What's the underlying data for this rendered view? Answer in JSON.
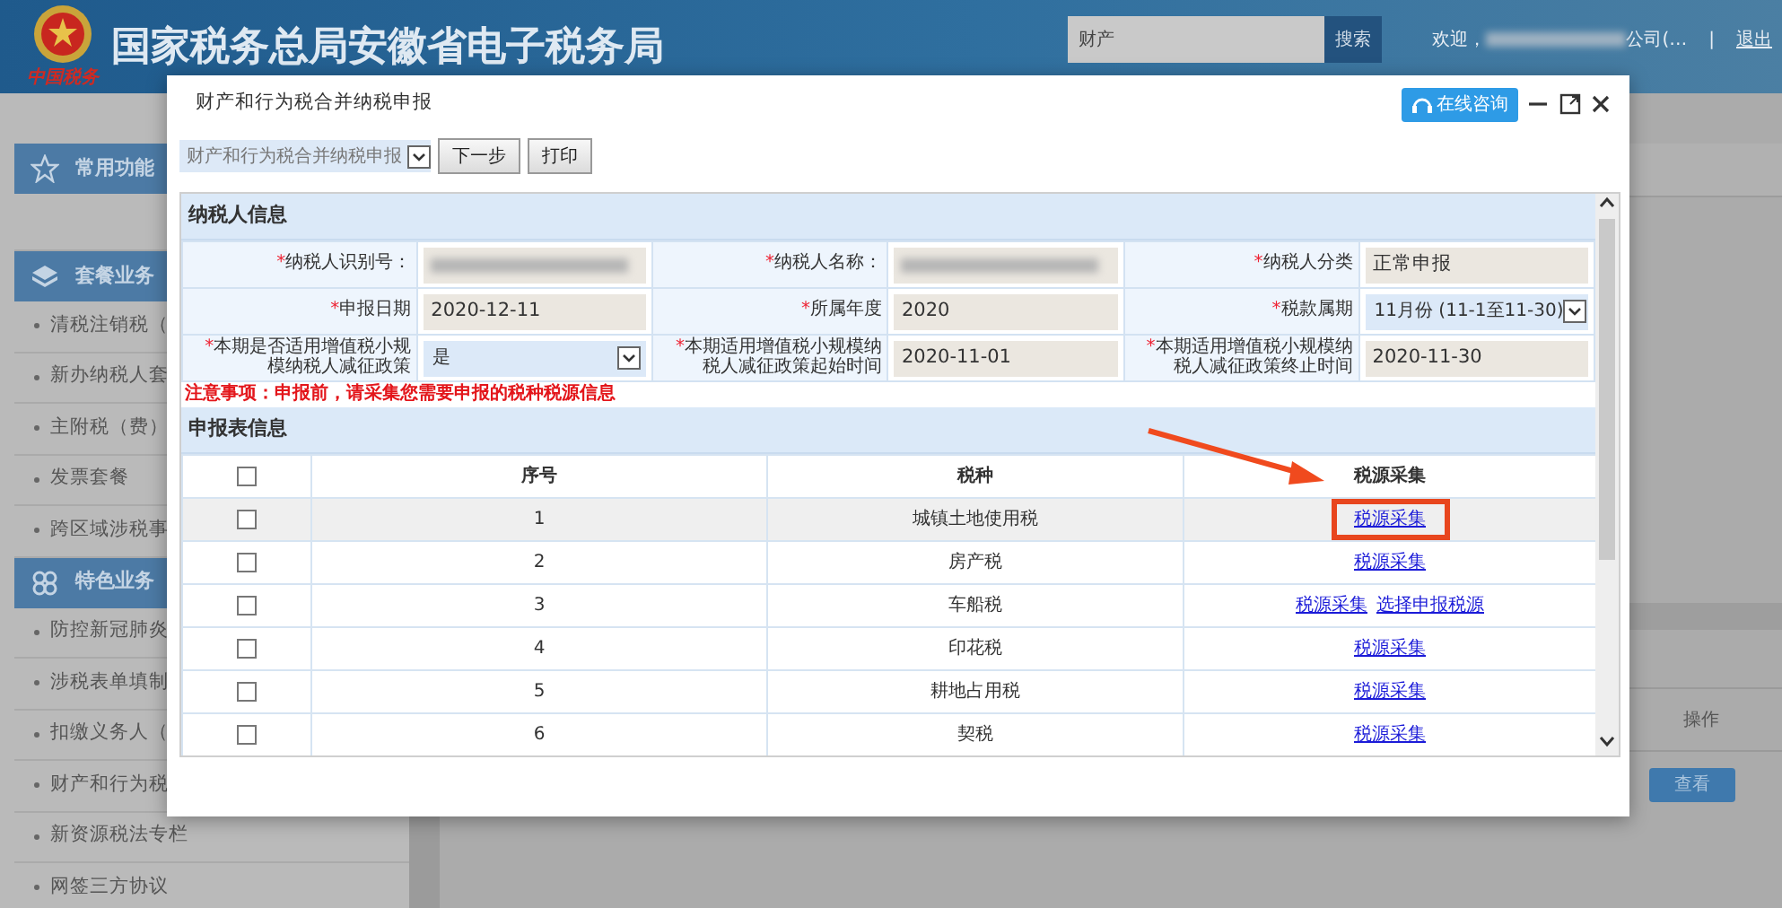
{
  "header": {
    "logo_text": "中国税务",
    "title": "国家税务总局安徽省电子税务局",
    "search": {
      "value": "财产"
    },
    "search_button": "搜索",
    "welcome": "欢迎，",
    "company_suffix": "公司(…",
    "separator": "|",
    "logout": "退出"
  },
  "sidebar": [
    {
      "label": "常用功能"
    },
    {
      "label": "套餐业务",
      "items": [
        "清税注销税（",
        "新办纳税人套",
        "主附税（费）",
        "发票套餐",
        "跨区域涉税事"
      ]
    },
    {
      "label": "特色业务",
      "items": [
        "防控新冠肺炎",
        "涉税表单填制",
        "扣缴义务人（",
        "财产和行为税",
        "新资源税法专栏",
        "网签三方协议"
      ]
    }
  ],
  "main": {
    "column_header": "操作",
    "view_button": "查看"
  },
  "dialog": {
    "title": "财产和行为税合并纳税申报",
    "consult_button": "在线咨询",
    "form_select": "财产和行为税合并纳税申报",
    "toolbar_buttons": [
      "下一步",
      "打印"
    ],
    "taxpayer_section": "纳税人信息",
    "fields": [
      {
        "mark": "*",
        "label": "纳税人识别号：",
        "kind": "redacted"
      },
      {
        "mark": "*",
        "label": "纳税人名称：",
        "kind": "redacted"
      },
      {
        "mark": "*",
        "label": "纳税人分类",
        "kind": "text",
        "value": "正常申报"
      },
      {
        "mark": "*",
        "label": "申报日期",
        "kind": "text",
        "value": "2020-12-11"
      },
      {
        "mark": "*",
        "label": "所属年度",
        "kind": "text",
        "value": "2020"
      },
      {
        "mark": "*",
        "label": "税款属期",
        "kind": "select",
        "value": "11月份 (11-1至11-30)"
      },
      {
        "mark": "*",
        "label": "本期是否适用增值税小规模纳税人减征政策",
        "kind": "select",
        "value": "是"
      },
      {
        "mark": "*",
        "label": "本期适用增值税小规模纳税人减征政策起始时间",
        "kind": "text",
        "value": "2020-11-01"
      },
      {
        "mark": "*",
        "label": "本期适用增值税小规模纳税人减征政策终止时间",
        "kind": "text",
        "value": "2020-11-30"
      }
    ],
    "notice": "注意事项：申报前，请采集您需要申报的税种税源信息",
    "table_section": "申报表信息",
    "table": {
      "select_all_checked": false,
      "columns": [
        "序号",
        "税种",
        "税源采集"
      ],
      "rows": [
        {
          "checked": false,
          "highlighted": true,
          "no": "1",
          "tax": "城镇土地使用税",
          "links": [
            {
              "text": "税源采集",
              "callout": true
            }
          ]
        },
        {
          "checked": false,
          "highlighted": false,
          "no": "2",
          "tax": "房产税",
          "links": [
            {
              "text": "税源采集",
              "callout": false
            }
          ]
        },
        {
          "checked": false,
          "highlighted": false,
          "no": "3",
          "tax": "车船税",
          "links": [
            {
              "text": "税源采集",
              "callout": false
            },
            {
              "text": "选择申报税源",
              "callout": false
            }
          ]
        },
        {
          "checked": false,
          "highlighted": false,
          "no": "4",
          "tax": "印花税",
          "links": [
            {
              "text": "税源采集",
              "callout": false
            }
          ]
        },
        {
          "checked": false,
          "highlighted": false,
          "no": "5",
          "tax": "耕地占用税",
          "links": [
            {
              "text": "税源采集",
              "callout": false
            }
          ]
        },
        {
          "checked": false,
          "highlighted": false,
          "no": "6",
          "tax": "契税",
          "links": [
            {
              "text": "税源采集",
              "callout": false
            }
          ]
        }
      ]
    }
  }
}
